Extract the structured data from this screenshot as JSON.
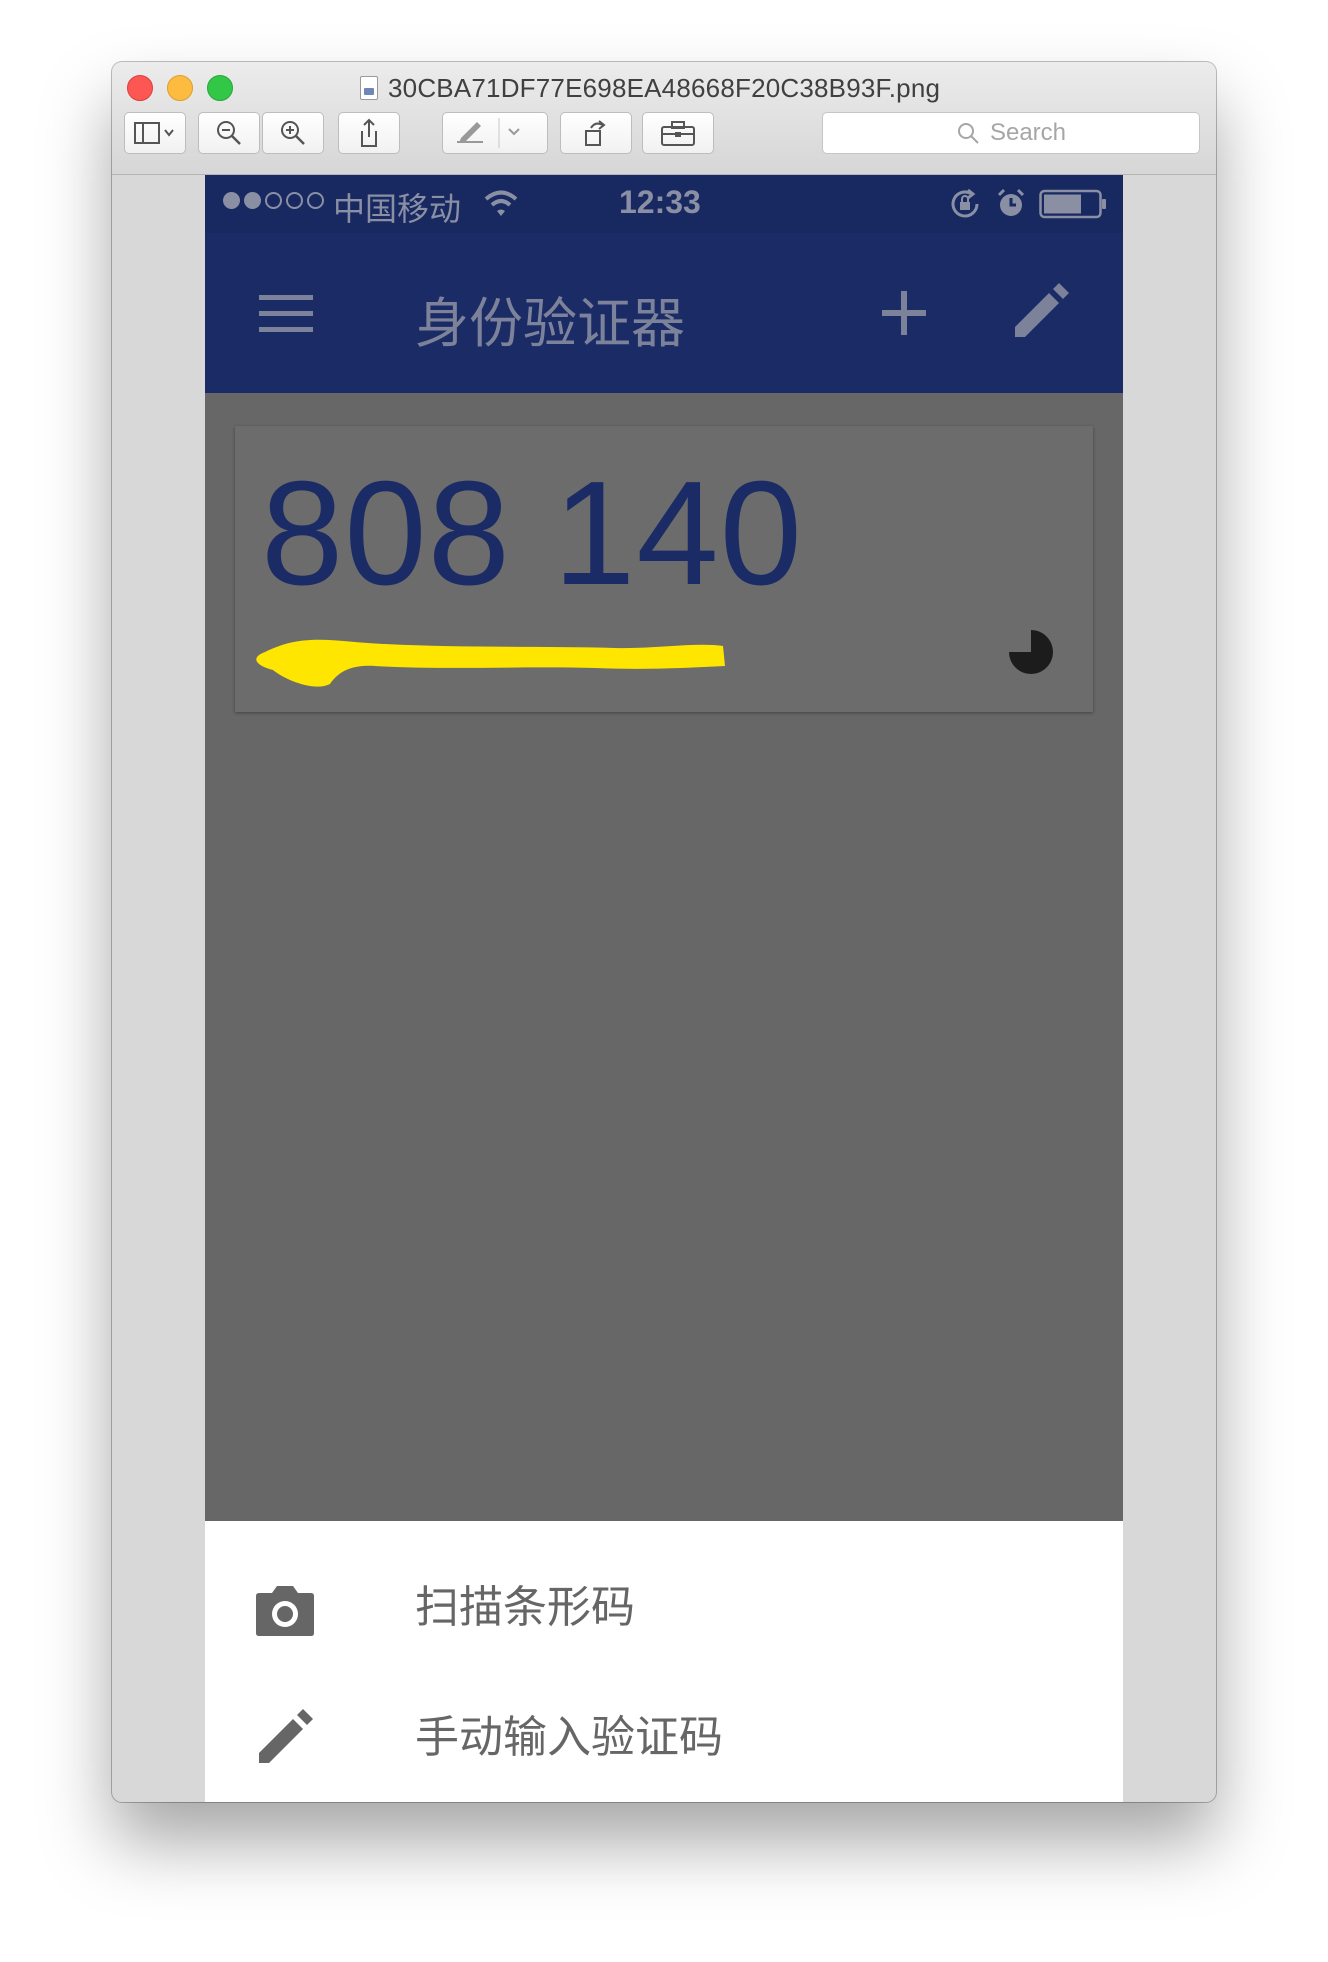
{
  "window": {
    "title": "30CBA71DF77E698EA48668F20C38B93F.png",
    "search_placeholder": "Search",
    "toolbar": {
      "sidebar_label": "sidebar-toggle",
      "zoom_out": "zoom-out-icon",
      "zoom_in": "zoom-in-icon",
      "share": "share-icon",
      "markup": "pen-icon",
      "rotate": "rotate-icon",
      "toolbox": "toolbox-icon"
    }
  },
  "phone": {
    "status": {
      "signal_dots_filled": 2,
      "signal_dots_total": 5,
      "carrier": "中国移动",
      "time": "12:33"
    },
    "app_bar": {
      "title": "身份验证器",
      "menu_icon": "menu-icon",
      "add_icon": "plus-icon",
      "edit_icon": "pencil-icon"
    },
    "account_card": {
      "code": "808 140",
      "timer_remaining_fraction": 0.75
    },
    "bottom_sheet": {
      "items": [
        {
          "label": "扫描条形码",
          "icon": "camera-icon"
        },
        {
          "label": "手动输入验证码",
          "icon": "pencil-icon"
        }
      ]
    },
    "colors": {
      "app_bar": "#1b2b66",
      "code": "#1b2b66",
      "redaction": "#ffe600"
    }
  }
}
